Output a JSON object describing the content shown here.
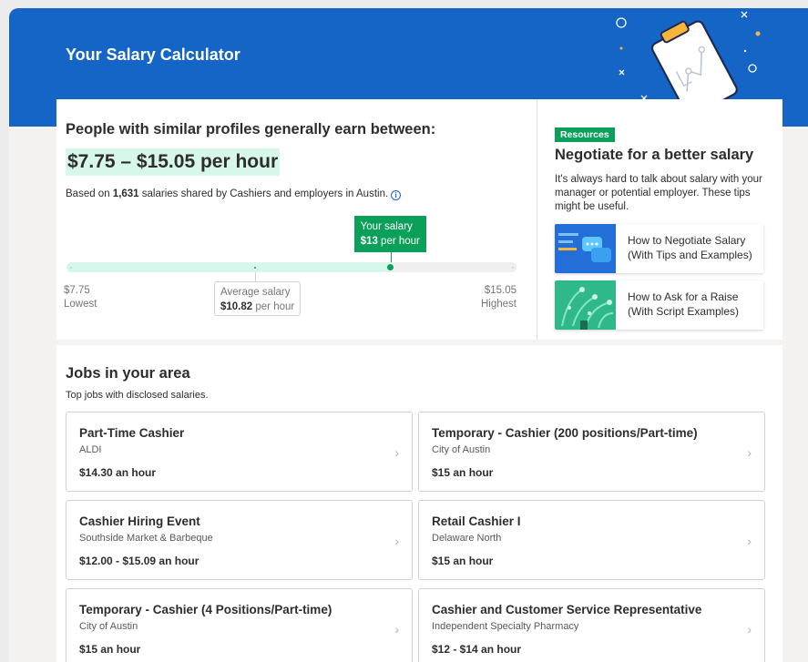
{
  "header": {
    "title": "Your Salary Calculator"
  },
  "summary": {
    "heading": "People with similar profiles generally earn between:",
    "range": "$7.75 – $15.05 per hour",
    "based_pre": "Based on ",
    "based_count": "1,631",
    "based_post": " salaries shared by Cashiers and employers in Austin.",
    "info_icon": "info-icon",
    "your_salary_label": "Your salary",
    "your_salary_value": "$13",
    "your_salary_unit": " per hour",
    "your_salary_fraction": 0.72,
    "average_fraction": 0.42,
    "low_value": "$7.75",
    "low_label": "Lowest",
    "high_value": "$15.05",
    "high_label": "Highest",
    "avg_label": "Average salary",
    "avg_value": "$10.82",
    "avg_unit": " per hour",
    "accent_color": "#0aa05a",
    "range_bg": "#d7f7ea"
  },
  "resources": {
    "badge": "Resources",
    "title": "Negotiate for a better salary",
    "body": "It's always hard to talk about salary with your manager or potential employer. These tips might be useful.",
    "articles": [
      {
        "title": "How to Negotiate Salary (With Tips and Examples)",
        "icon": "chat-illustration-icon"
      },
      {
        "title": "How to Ask for a Raise (With Script Examples)",
        "icon": "plant-illustration-icon"
      }
    ]
  },
  "jobs": {
    "title": "Jobs in your area",
    "subtitle": "Top jobs with disclosed salaries.",
    "items": [
      {
        "title": "Part-Time Cashier",
        "company": "ALDI",
        "pay": "$14.30 an hour"
      },
      {
        "title": "Temporary - Cashier (200 positions/Part-time)",
        "company": "City of Austin",
        "pay": "$15 an hour"
      },
      {
        "title": "Cashier Hiring Event",
        "company": "Southside Market & Barbeque",
        "pay": "$12.00 - $15.09 an hour"
      },
      {
        "title": "Retail Cashier I",
        "company": "Delaware North",
        "pay": "$15 an hour"
      },
      {
        "title": "Temporary - Cashier (4 Positions/Part-time)",
        "company": "City of Austin",
        "pay": "$15 an hour"
      },
      {
        "title": "Cashier and Customer Service Representative",
        "company": "Independent Specialty Pharmacy",
        "pay": "$12 - $14 an hour"
      }
    ],
    "chevron_icon": "chevron-right-icon"
  },
  "colors": {
    "brand_blue": "#1565c6",
    "accent_green": "#0aa05a"
  }
}
